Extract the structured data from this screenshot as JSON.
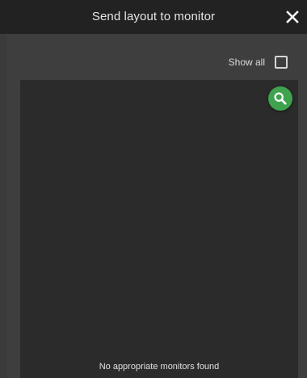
{
  "dialog": {
    "title": "Send layout to monitor",
    "close_icon": "close-icon"
  },
  "filter": {
    "show_all_label": "Show all",
    "show_all_checked": false
  },
  "panel": {
    "search_icon": "search-icon",
    "empty_message": "No appropriate monitors found"
  },
  "colors": {
    "titlebar": "#222222",
    "dialog_bg": "#3e3e3e",
    "panel_bg": "#2b2b2b",
    "accent": "#3fa24f"
  }
}
